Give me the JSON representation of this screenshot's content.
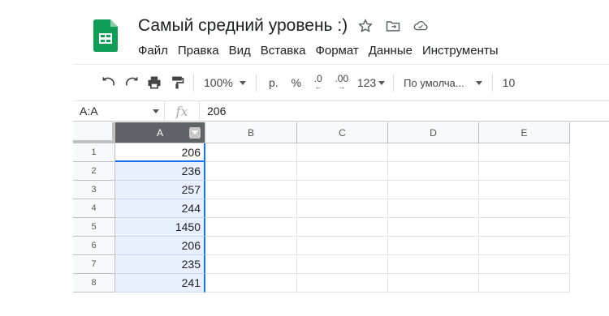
{
  "doc": {
    "title": "Самый средний уровень :)",
    "icons": [
      "star-icon",
      "move-to-folder-icon",
      "cloud-saved-icon"
    ]
  },
  "menu": [
    "Файл",
    "Правка",
    "Вид",
    "Вставка",
    "Формат",
    "Данные",
    "Инструменты"
  ],
  "toolbar": {
    "zoom": "100%",
    "currency": "р.",
    "percent": "%",
    "decrease_decimal": ".0",
    "increase_decimal": ".00",
    "more_formats": "123",
    "font": "По умолча...",
    "font_size": "10"
  },
  "formula_bar": {
    "name_box": "A:A",
    "fx": "fx",
    "value": "206"
  },
  "columns": [
    "A",
    "B",
    "C",
    "D",
    "E"
  ],
  "rows": [
    {
      "num": "1",
      "a": "206"
    },
    {
      "num": "2",
      "a": "236"
    },
    {
      "num": "3",
      "a": "257"
    },
    {
      "num": "4",
      "a": "244"
    },
    {
      "num": "5",
      "a": "1450"
    },
    {
      "num": "6",
      "a": "206"
    },
    {
      "num": "7",
      "a": "235"
    },
    {
      "num": "8",
      "a": "241"
    }
  ],
  "colors": {
    "accent": "#1a73e8",
    "selection": "#e8f0fe",
    "sheets_green": "#0f9d58"
  }
}
